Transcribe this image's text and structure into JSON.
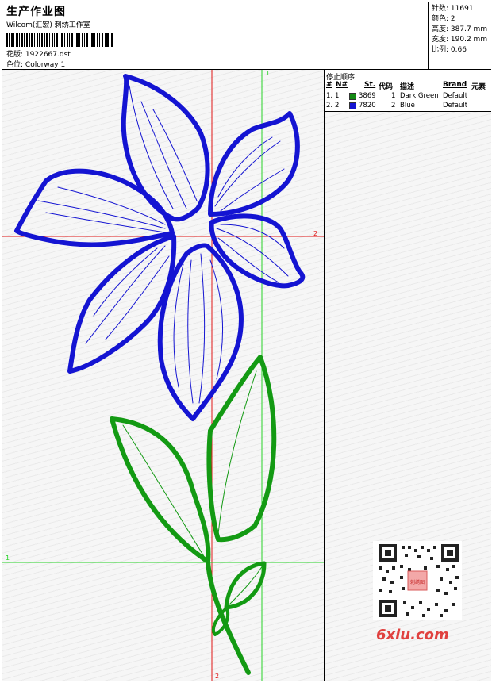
{
  "header": {
    "title": "生产作业图",
    "subtitle": "Wilcom(汇宏) 刺绣工作室",
    "design_label": "花版:",
    "design_value": "1922667.dst",
    "colorway_label": "色位:",
    "colorway_value": "Colorway 1"
  },
  "stats": {
    "stitches_label": "针数:",
    "stitches_value": "11691",
    "colors_label": "颜色:",
    "colors_value": "2",
    "height_label": "高度:",
    "height_value": "387.7 mm",
    "width_label": "宽度:",
    "width_value": "190.2 mm",
    "scale_label": "比例:",
    "scale_value": "0.66"
  },
  "stop_sequence": {
    "label": "停止顺序:",
    "columns": [
      "#",
      "N#",
      "St.",
      "代码",
      "描述",
      "Brand",
      "元素"
    ],
    "rows": [
      {
        "idx": "1.",
        "n": "1",
        "color": "#138a13",
        "stitches": "3869",
        "code": "1",
        "desc": "Dark Green",
        "brand": "Default"
      },
      {
        "idx": "2.",
        "n": "2",
        "color": "#1414d2",
        "stitches": "7820",
        "code": "2",
        "desc": "Blue",
        "brand": "Default"
      }
    ]
  },
  "guides": {
    "top_green": "1",
    "right_red": "2",
    "left_green": "1",
    "bottom_red": "2"
  },
  "watermark": {
    "logo_text": "6xiu.com",
    "badge_text": "刺绣图"
  },
  "colors": {
    "blue_thread": "#1414d2",
    "green_thread": "#139a13",
    "red_guide": "#e01515",
    "green_guide": "#27d327"
  }
}
